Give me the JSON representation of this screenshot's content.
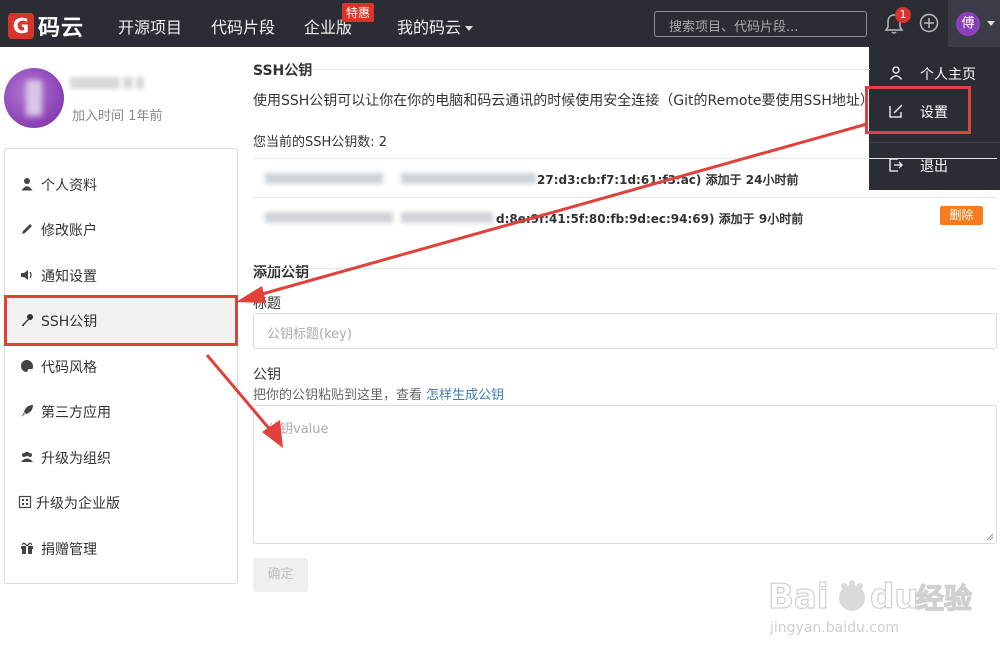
{
  "nav": {
    "logo_mark": "G",
    "logo_text": "码云",
    "links": [
      "开源项目",
      "代码片段",
      "企业版",
      "我的码云"
    ],
    "special_badge": "特惠",
    "search_placeholder": "搜索项目、代码片段...",
    "notification_count": "1",
    "avatar_initial": "傅"
  },
  "dropdown": {
    "items": [
      "个人主页",
      "设置",
      "退出"
    ]
  },
  "profile": {
    "join_text": "加入时间 1年前"
  },
  "sidebar": {
    "items": [
      "个人资料",
      "修改账户",
      "通知设置",
      "SSH公钥",
      "代码风格",
      "第三方应用",
      "升级为组织",
      "升级为企业版",
      "捐赠管理"
    ]
  },
  "ssh": {
    "title": "SSH公钥",
    "description": "使用SSH公钥可以让你在你的电脑和码云通讯的时候使用安全连接（Git的Remote要使用SSH地址）",
    "count_text": "您当前的SSH公钥数: 2",
    "keys": [
      {
        "fingerprint_tail": "27:d3:cb:f7:1d:61:f3:ac) 添加于 24小时前"
      },
      {
        "fingerprint_tail": "d:8e:9f:41:5f:80:fb:9d:ec:94:69) 添加于 9小时前"
      }
    ],
    "delete_label": "删除"
  },
  "add_key": {
    "title": "添加公钥",
    "label_title": "标题",
    "title_placeholder": "公钥标题(key)",
    "label_key": "公钥",
    "hint_text": "把你的公钥粘贴到这里，查看 ",
    "hint_link": "怎样生成公钥",
    "key_placeholder": "公钥value",
    "submit_label": "确定"
  },
  "watermark": {
    "brand": "Baidu经验",
    "url": "jingyan.baidu.com"
  },
  "colors": {
    "nav_bg": "#2b2d35",
    "brand_red": "#d9342b",
    "annotation_red": "#e0413a",
    "delete_orange": "#f57c1f"
  }
}
